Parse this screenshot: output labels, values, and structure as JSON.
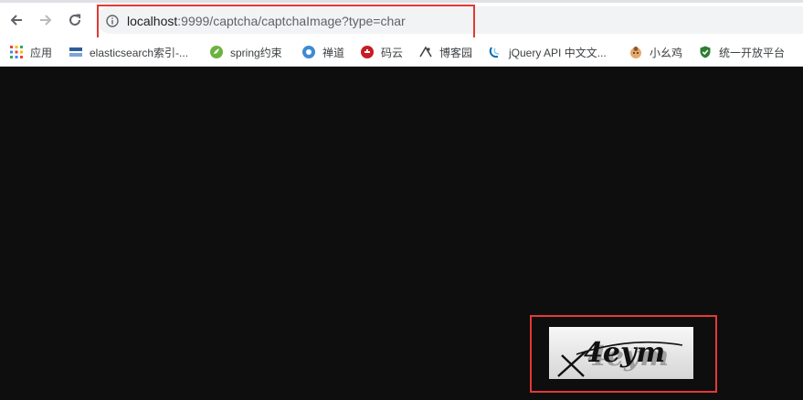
{
  "address_bar": {
    "url_host": "localhost",
    "url_path": ":9999/captcha/captchaImage?type=char"
  },
  "bookmarks": [
    {
      "label": "应用",
      "icon": "apps-grid-icon",
      "color": "#1a73e8"
    },
    {
      "label": "elasticsearch索引-...",
      "icon": "elasticsearch-icon",
      "color": "#2e5c99"
    },
    {
      "label": "spring约束",
      "icon": "spring-leaf-icon",
      "color": "#6db33f"
    },
    {
      "label": "禅道",
      "icon": "zentao-icon",
      "color": "#3d8bd3"
    },
    {
      "label": "码云",
      "icon": "gitee-icon",
      "color": "#c71d23"
    },
    {
      "label": "博客园",
      "icon": "cnblogs-icon",
      "color": "#444444"
    },
    {
      "label": "jQuery API 中文文...",
      "icon": "jquery-icon",
      "color": "#0769ad"
    },
    {
      "label": "小幺鸡",
      "icon": "xiaoyaoji-icon",
      "color": "#e8a86c"
    },
    {
      "label": "统一开放平台",
      "icon": "shield-check-icon",
      "color": "#2e7d32"
    }
  ],
  "captcha": {
    "text": "4eym",
    "icon": "captcha-image"
  },
  "colors": {
    "highlight": "#e53935",
    "page_background": "#0e0e0e"
  }
}
